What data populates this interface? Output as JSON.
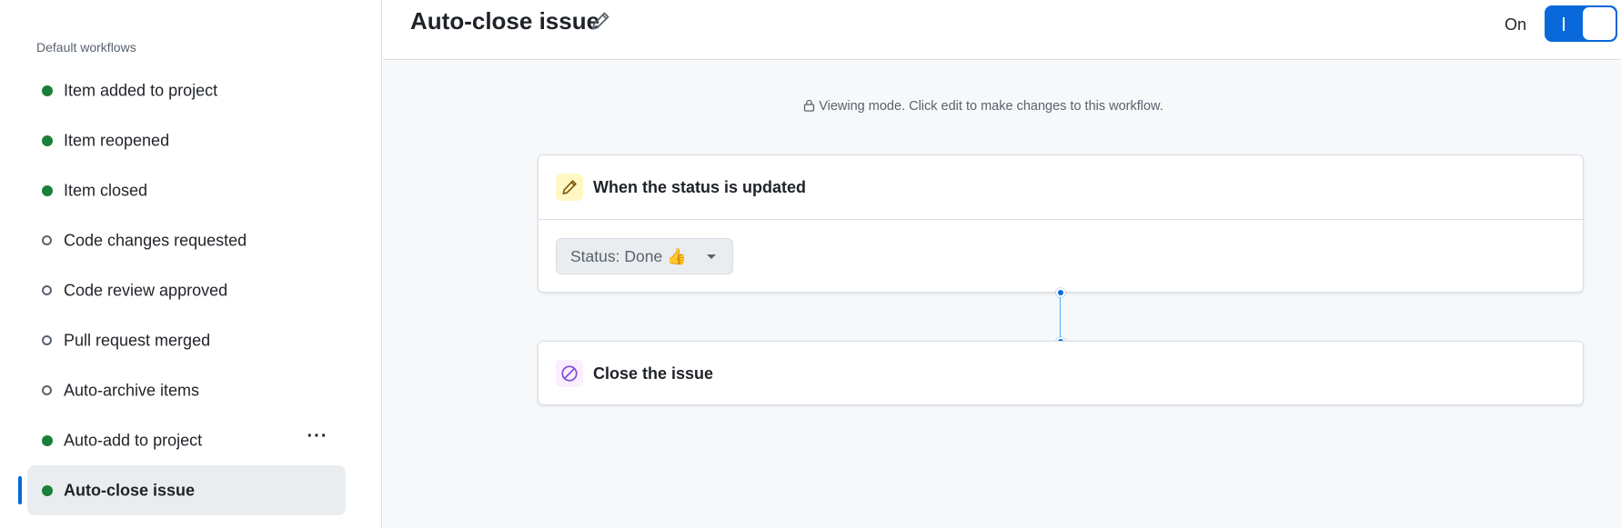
{
  "sidebar": {
    "heading": "Default workflows",
    "items": [
      {
        "label": "Item added to project",
        "enabled": true
      },
      {
        "label": "Item reopened",
        "enabled": true
      },
      {
        "label": "Item closed",
        "enabled": true
      },
      {
        "label": "Code changes requested",
        "enabled": false
      },
      {
        "label": "Code review approved",
        "enabled": false
      },
      {
        "label": "Pull request merged",
        "enabled": false
      },
      {
        "label": "Auto-archive items",
        "enabled": false
      },
      {
        "label": "Auto-add to project",
        "enabled": true,
        "has_menu": true
      },
      {
        "label": "Auto-close issue",
        "enabled": true,
        "selected": true
      }
    ],
    "more_icon": "kebab-horizontal-icon"
  },
  "header": {
    "title": "Auto-close issue",
    "edit_icon": "pencil-icon",
    "toggle_label": "On",
    "toggle_on": true
  },
  "canvas": {
    "viewing_note": "Viewing mode. Click edit to make changes to this workflow.",
    "trigger": {
      "icon": "pencil-icon",
      "title": "When the status is updated",
      "status_value": "Status: Done 👍"
    },
    "action": {
      "icon": "circle-slash-icon",
      "title": "Close the issue"
    }
  },
  "colors": {
    "accent": "#0969da",
    "enabled_dot": "#1a7f37",
    "trigger_icon_bg": "#fff8c5",
    "action_icon_bg": "#fbefff",
    "action_icon": "#8250df"
  }
}
